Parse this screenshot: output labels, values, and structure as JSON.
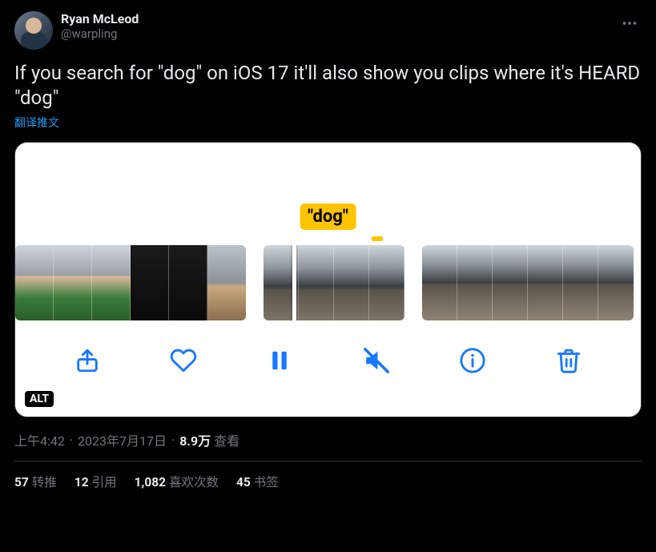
{
  "author": {
    "display_name": "Ryan McLeod",
    "handle": "@warpling"
  },
  "tweet_text": "If you search for \"dog\" on iOS 17 it'll also show you clips where it's HEARD \"dog\"",
  "translate_label": "翻译推文",
  "media": {
    "search_term_label": "\"dog\"",
    "alt_badge": "ALT",
    "toolbar_icons": {
      "share": "share-icon",
      "like": "heart-icon",
      "pause": "pause-icon",
      "mute": "sound-off-icon",
      "info": "info-icon",
      "delete": "trash-icon"
    }
  },
  "meta": {
    "time": "上午4:42",
    "date": "2023年7月17日",
    "views_count": "8.9万",
    "views_label": "查看"
  },
  "stats": {
    "retweets": {
      "count": "57",
      "label": "转推"
    },
    "quotes": {
      "count": "12",
      "label": "引用"
    },
    "likes": {
      "count": "1,082",
      "label": "喜欢次数"
    },
    "bookmarks": {
      "count": "45",
      "label": "书签"
    }
  }
}
